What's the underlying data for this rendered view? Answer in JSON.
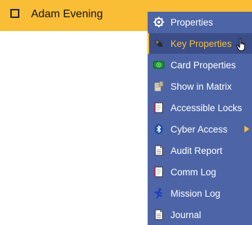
{
  "row": {
    "name": "Adam Evening"
  },
  "menu": {
    "items": [
      {
        "label": "Properties",
        "icon": "gear-icon"
      },
      {
        "label": "Key Properties",
        "icon": "key-icon",
        "selected": true
      },
      {
        "label": "Card Properties",
        "icon": "card-icon"
      },
      {
        "label": "Show in Matrix",
        "icon": "matrix-icon"
      },
      {
        "label": "Accessible Locks",
        "icon": "lock-doc-icon"
      },
      {
        "label": "Cyber Access",
        "icon": "bluetooth-icon",
        "has_submenu": true
      },
      {
        "label": "Audit Report",
        "icon": "report-icon"
      },
      {
        "label": "Comm Log",
        "icon": "comm-log-icon"
      },
      {
        "label": "Mission Log",
        "icon": "mission-log-icon"
      },
      {
        "label": "Journal",
        "icon": "journal-icon"
      }
    ]
  },
  "colors": {
    "header": "#F9BE36",
    "menu_bg": "#4D65A6",
    "highlight_text": "#F9BE36"
  }
}
